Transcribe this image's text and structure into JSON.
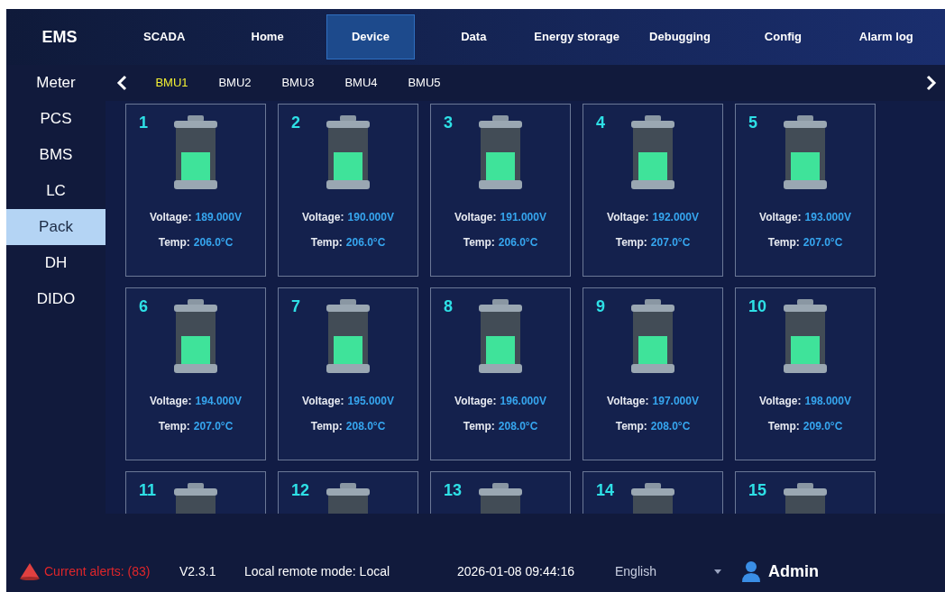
{
  "brand": "EMS",
  "nav": [
    {
      "label": "SCADA",
      "selected": false
    },
    {
      "label": "Home",
      "selected": false
    },
    {
      "label": "Device",
      "selected": true
    },
    {
      "label": "Data",
      "selected": false
    },
    {
      "label": "Energy storage",
      "selected": false
    },
    {
      "label": "Debugging",
      "selected": false
    },
    {
      "label": "Config",
      "selected": false
    },
    {
      "label": "Alarm log",
      "selected": false
    }
  ],
  "sidebar": [
    {
      "label": "Meter",
      "selected": false
    },
    {
      "label": "PCS",
      "selected": false
    },
    {
      "label": "BMS",
      "selected": false
    },
    {
      "label": "LC",
      "selected": false
    },
    {
      "label": "Pack",
      "selected": true
    },
    {
      "label": "DH",
      "selected": false
    },
    {
      "label": "DIDO",
      "selected": false
    }
  ],
  "bmu_tabs": [
    {
      "label": "BMU1",
      "selected": true
    },
    {
      "label": "BMU2",
      "selected": false
    },
    {
      "label": "BMU3",
      "selected": false
    },
    {
      "label": "BMU4",
      "selected": false
    },
    {
      "label": "BMU5",
      "selected": false
    }
  ],
  "packs": [
    {
      "number": "1",
      "level": 0.55,
      "voltage_label": "Voltage:",
      "voltage": "189.000V",
      "temp_label": "Temp:",
      "temp": "206.0°C"
    },
    {
      "number": "2",
      "level": 0.55,
      "voltage_label": "Voltage:",
      "voltage": "190.000V",
      "temp_label": "Temp:",
      "temp": "206.0°C"
    },
    {
      "number": "3",
      "level": 0.55,
      "voltage_label": "Voltage:",
      "voltage": "191.000V",
      "temp_label": "Temp:",
      "temp": "206.0°C"
    },
    {
      "number": "4",
      "level": 0.55,
      "voltage_label": "Voltage:",
      "voltage": "192.000V",
      "temp_label": "Temp:",
      "temp": "207.0°C"
    },
    {
      "number": "5",
      "level": 0.55,
      "voltage_label": "Voltage:",
      "voltage": "193.000V",
      "temp_label": "Temp:",
      "temp": "207.0°C"
    },
    {
      "number": "6",
      "level": 0.55,
      "voltage_label": "Voltage:",
      "voltage": "194.000V",
      "temp_label": "Temp:",
      "temp": "207.0°C"
    },
    {
      "number": "7",
      "level": 0.55,
      "voltage_label": "Voltage:",
      "voltage": "195.000V",
      "temp_label": "Temp:",
      "temp": "208.0°C"
    },
    {
      "number": "8",
      "level": 0.55,
      "voltage_label": "Voltage:",
      "voltage": "196.000V",
      "temp_label": "Temp:",
      "temp": "208.0°C"
    },
    {
      "number": "9",
      "level": 0.55,
      "voltage_label": "Voltage:",
      "voltage": "197.000V",
      "temp_label": "Temp:",
      "temp": "208.0°C"
    },
    {
      "number": "10",
      "level": 0.55,
      "voltage_label": "Voltage:",
      "voltage": "198.000V",
      "temp_label": "Temp:",
      "temp": "209.0°C"
    },
    {
      "number": "11"
    },
    {
      "number": "12"
    },
    {
      "number": "13"
    },
    {
      "number": "14"
    },
    {
      "number": "15"
    }
  ],
  "status_bar": {
    "alerts": "Current alerts: (83)",
    "version": "V2.3.1",
    "mode": "Local remote mode: Local",
    "datetime": "2026-01-08 09:44:16",
    "language": "English",
    "user": "Admin"
  }
}
